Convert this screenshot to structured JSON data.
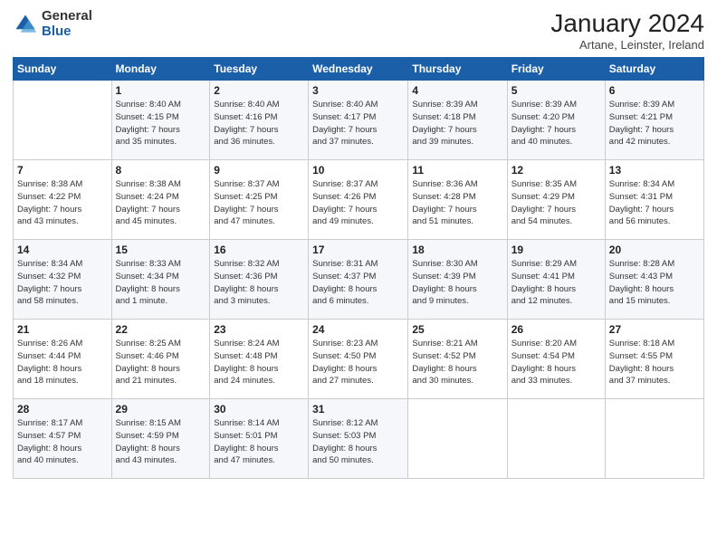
{
  "logo": {
    "general": "General",
    "blue": "Blue"
  },
  "title": "January 2024",
  "subtitle": "Artane, Leinster, Ireland",
  "days_header": [
    "Sunday",
    "Monday",
    "Tuesday",
    "Wednesday",
    "Thursday",
    "Friday",
    "Saturday"
  ],
  "weeks": [
    [
      {
        "day": "",
        "info": ""
      },
      {
        "day": "1",
        "info": "Sunrise: 8:40 AM\nSunset: 4:15 PM\nDaylight: 7 hours\nand 35 minutes."
      },
      {
        "day": "2",
        "info": "Sunrise: 8:40 AM\nSunset: 4:16 PM\nDaylight: 7 hours\nand 36 minutes."
      },
      {
        "day": "3",
        "info": "Sunrise: 8:40 AM\nSunset: 4:17 PM\nDaylight: 7 hours\nand 37 minutes."
      },
      {
        "day": "4",
        "info": "Sunrise: 8:39 AM\nSunset: 4:18 PM\nDaylight: 7 hours\nand 39 minutes."
      },
      {
        "day": "5",
        "info": "Sunrise: 8:39 AM\nSunset: 4:20 PM\nDaylight: 7 hours\nand 40 minutes."
      },
      {
        "day": "6",
        "info": "Sunrise: 8:39 AM\nSunset: 4:21 PM\nDaylight: 7 hours\nand 42 minutes."
      }
    ],
    [
      {
        "day": "7",
        "info": "Sunrise: 8:38 AM\nSunset: 4:22 PM\nDaylight: 7 hours\nand 43 minutes."
      },
      {
        "day": "8",
        "info": "Sunrise: 8:38 AM\nSunset: 4:24 PM\nDaylight: 7 hours\nand 45 minutes."
      },
      {
        "day": "9",
        "info": "Sunrise: 8:37 AM\nSunset: 4:25 PM\nDaylight: 7 hours\nand 47 minutes."
      },
      {
        "day": "10",
        "info": "Sunrise: 8:37 AM\nSunset: 4:26 PM\nDaylight: 7 hours\nand 49 minutes."
      },
      {
        "day": "11",
        "info": "Sunrise: 8:36 AM\nSunset: 4:28 PM\nDaylight: 7 hours\nand 51 minutes."
      },
      {
        "day": "12",
        "info": "Sunrise: 8:35 AM\nSunset: 4:29 PM\nDaylight: 7 hours\nand 54 minutes."
      },
      {
        "day": "13",
        "info": "Sunrise: 8:34 AM\nSunset: 4:31 PM\nDaylight: 7 hours\nand 56 minutes."
      }
    ],
    [
      {
        "day": "14",
        "info": "Sunrise: 8:34 AM\nSunset: 4:32 PM\nDaylight: 7 hours\nand 58 minutes."
      },
      {
        "day": "15",
        "info": "Sunrise: 8:33 AM\nSunset: 4:34 PM\nDaylight: 8 hours\nand 1 minute."
      },
      {
        "day": "16",
        "info": "Sunrise: 8:32 AM\nSunset: 4:36 PM\nDaylight: 8 hours\nand 3 minutes."
      },
      {
        "day": "17",
        "info": "Sunrise: 8:31 AM\nSunset: 4:37 PM\nDaylight: 8 hours\nand 6 minutes."
      },
      {
        "day": "18",
        "info": "Sunrise: 8:30 AM\nSunset: 4:39 PM\nDaylight: 8 hours\nand 9 minutes."
      },
      {
        "day": "19",
        "info": "Sunrise: 8:29 AM\nSunset: 4:41 PM\nDaylight: 8 hours\nand 12 minutes."
      },
      {
        "day": "20",
        "info": "Sunrise: 8:28 AM\nSunset: 4:43 PM\nDaylight: 8 hours\nand 15 minutes."
      }
    ],
    [
      {
        "day": "21",
        "info": "Sunrise: 8:26 AM\nSunset: 4:44 PM\nDaylight: 8 hours\nand 18 minutes."
      },
      {
        "day": "22",
        "info": "Sunrise: 8:25 AM\nSunset: 4:46 PM\nDaylight: 8 hours\nand 21 minutes."
      },
      {
        "day": "23",
        "info": "Sunrise: 8:24 AM\nSunset: 4:48 PM\nDaylight: 8 hours\nand 24 minutes."
      },
      {
        "day": "24",
        "info": "Sunrise: 8:23 AM\nSunset: 4:50 PM\nDaylight: 8 hours\nand 27 minutes."
      },
      {
        "day": "25",
        "info": "Sunrise: 8:21 AM\nSunset: 4:52 PM\nDaylight: 8 hours\nand 30 minutes."
      },
      {
        "day": "26",
        "info": "Sunrise: 8:20 AM\nSunset: 4:54 PM\nDaylight: 8 hours\nand 33 minutes."
      },
      {
        "day": "27",
        "info": "Sunrise: 8:18 AM\nSunset: 4:55 PM\nDaylight: 8 hours\nand 37 minutes."
      }
    ],
    [
      {
        "day": "28",
        "info": "Sunrise: 8:17 AM\nSunset: 4:57 PM\nDaylight: 8 hours\nand 40 minutes."
      },
      {
        "day": "29",
        "info": "Sunrise: 8:15 AM\nSunset: 4:59 PM\nDaylight: 8 hours\nand 43 minutes."
      },
      {
        "day": "30",
        "info": "Sunrise: 8:14 AM\nSunset: 5:01 PM\nDaylight: 8 hours\nand 47 minutes."
      },
      {
        "day": "31",
        "info": "Sunrise: 8:12 AM\nSunset: 5:03 PM\nDaylight: 8 hours\nand 50 minutes."
      },
      {
        "day": "",
        "info": ""
      },
      {
        "day": "",
        "info": ""
      },
      {
        "day": "",
        "info": ""
      }
    ]
  ]
}
